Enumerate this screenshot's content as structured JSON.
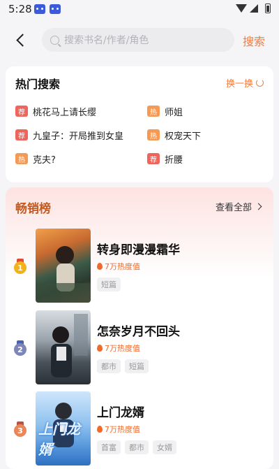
{
  "status_bar": {
    "time": "5:28"
  },
  "search": {
    "placeholder": "搜索书名/作者/角色",
    "submit_label": "搜索"
  },
  "hot_search": {
    "title": "热门搜索",
    "refresh_label": "换一换",
    "items": [
      {
        "tag": "荐",
        "tag_type": "recommend",
        "label": "桃花马上请长缨"
      },
      {
        "tag": "热",
        "tag_type": "hot",
        "label": "师姐"
      },
      {
        "tag": "荐",
        "tag_type": "recommend",
        "label": "九皇子：开局推到女皇"
      },
      {
        "tag": "热",
        "tag_type": "hot",
        "label": "权宠天下"
      },
      {
        "tag": "热",
        "tag_type": "hot",
        "label": "克夫?"
      },
      {
        "tag": "荐",
        "tag_type": "recommend",
        "label": "折腰"
      }
    ]
  },
  "bestseller": {
    "title": "畅销榜",
    "view_all_label": "查看全部",
    "books": [
      {
        "rank": "1",
        "title": "转身即漫漫霜华",
        "heat": "7万热度值",
        "tags": [
          "短篇"
        ],
        "cover_text": ""
      },
      {
        "rank": "2",
        "title": "怎奈岁月不回头",
        "heat": "7万热度值",
        "tags": [
          "都市",
          "短篇"
        ],
        "cover_text": ""
      },
      {
        "rank": "3",
        "title": "上门龙婿",
        "heat": "7万热度值",
        "tags": [
          "首富",
          "都市",
          "女婿"
        ],
        "cover_text": "上门龙婿"
      }
    ]
  },
  "colors": {
    "accent": "#f47b3c",
    "recommend_tag": "#f0645c",
    "hot_tag": "#f59a55",
    "rank_title": "#c45a22",
    "medal_gold": "#f2b21c",
    "medal_silver": "#7c86b8",
    "medal_bronze": "#e8875a"
  }
}
